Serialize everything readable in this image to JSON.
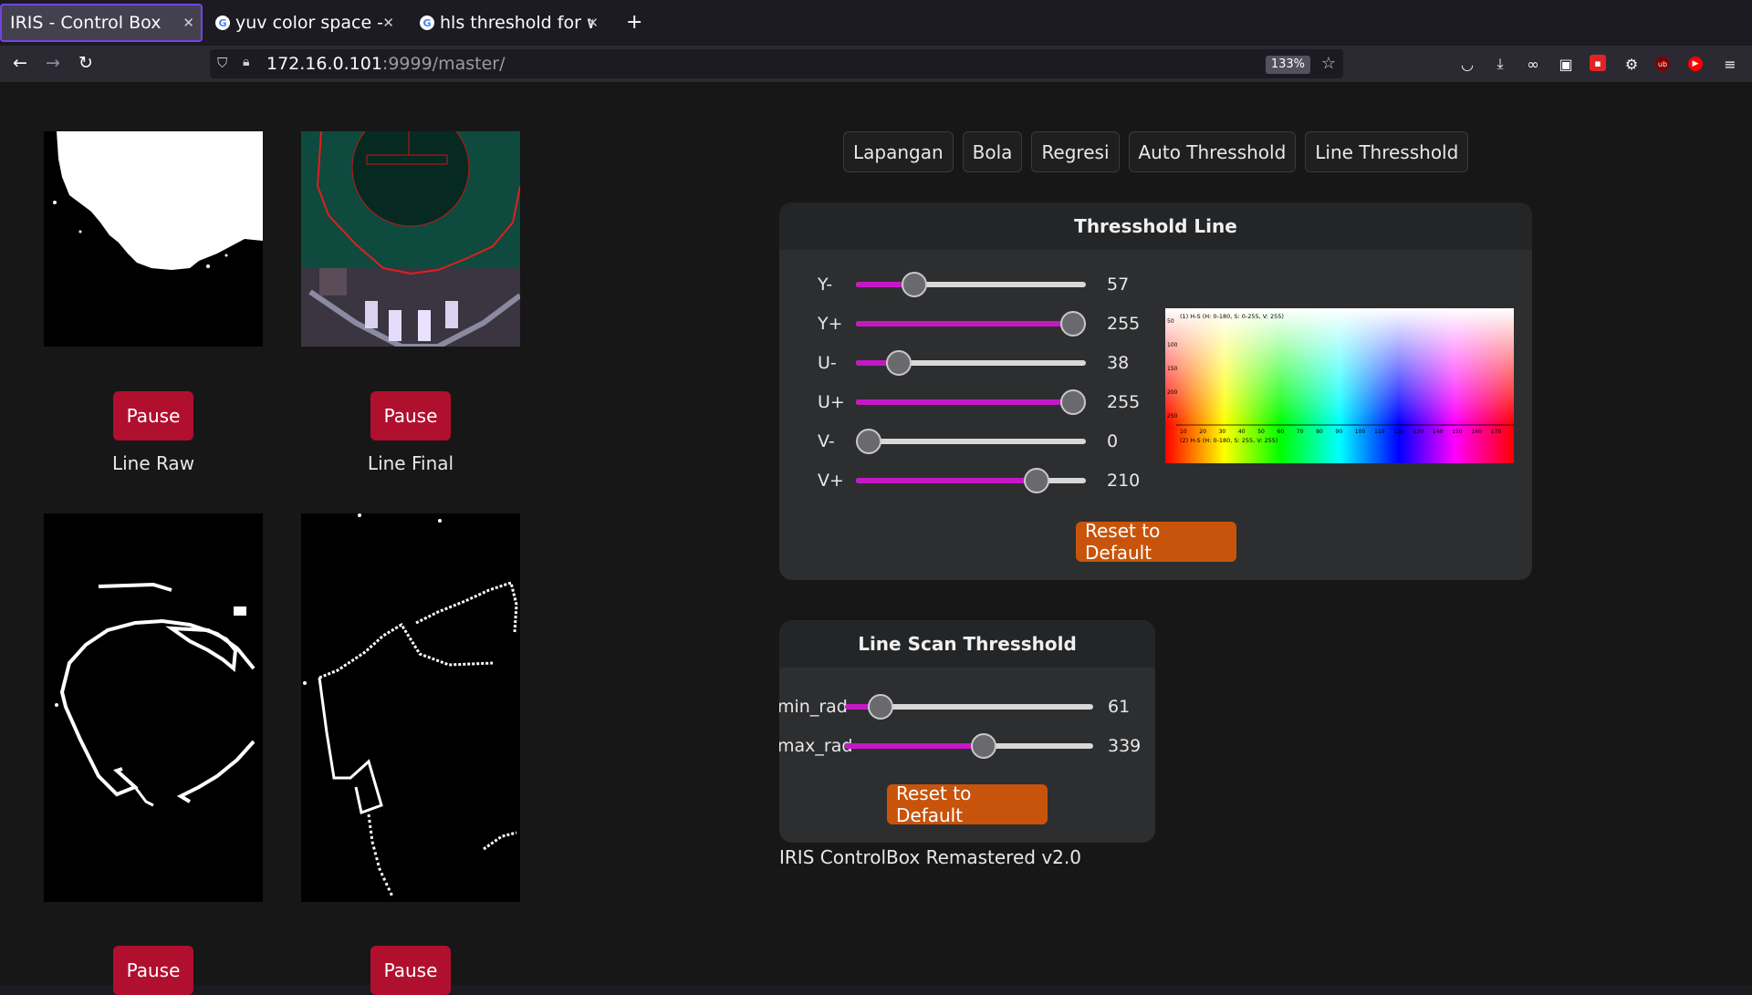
{
  "browser": {
    "tabs": [
      {
        "title": "IRIS - Control Box"
      },
      {
        "title": "yuv color space - Go"
      },
      {
        "title": "hls threshold for wh"
      }
    ],
    "url_host": "172.16.0.101",
    "url_rest": ":9999/master/",
    "zoom": "133%"
  },
  "feeds": [
    {
      "label": "Line Raw",
      "button": "Pause"
    },
    {
      "label": "Line Final",
      "button": "Pause"
    },
    {
      "label": "",
      "button": "Pause"
    },
    {
      "label": "",
      "button": "Pause"
    }
  ],
  "nav_tabs": [
    "Lapangan",
    "Bola",
    "Regresi",
    "Auto Thresshold",
    "Line Thresshold"
  ],
  "threshold_line": {
    "title": "Thresshold Line",
    "sliders": [
      {
        "label": "Y-",
        "value": 57,
        "max": 255
      },
      {
        "label": "Y+",
        "value": 255,
        "max": 255
      },
      {
        "label": "U-",
        "value": 38,
        "max": 255
      },
      {
        "label": "U+",
        "value": 255,
        "max": 255
      },
      {
        "label": "V-",
        "value": 0,
        "max": 255
      },
      {
        "label": "V+",
        "value": 210,
        "max": 255
      }
    ],
    "chart_top_caption": "(1) H-S (H: 0-180, S: 0-255, V: 255)",
    "chart_bottom_caption": "(2) H-S (H: 0-180, S: 255, V: 255)",
    "y_ticks": [
      "50",
      "100",
      "150",
      "200",
      "250"
    ],
    "x_ticks": [
      "10",
      "20",
      "30",
      "40",
      "50",
      "60",
      "70",
      "80",
      "90",
      "100",
      "110",
      "120",
      "130",
      "140",
      "150",
      "160",
      "170"
    ],
    "reset": "Reset to Default"
  },
  "line_scan": {
    "title": "Line Scan Thresshold",
    "sliders": [
      {
        "label": "min_rad",
        "value": 61,
        "max": 600
      },
      {
        "label": "max_rad",
        "value": 339,
        "max": 600
      }
    ],
    "reset": "Reset to Default"
  },
  "footer": "IRIS ControlBox Remastered v2.0"
}
